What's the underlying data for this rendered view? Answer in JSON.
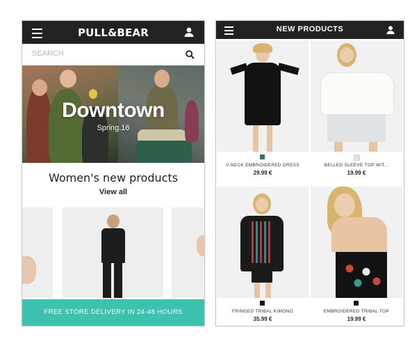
{
  "left_screen": {
    "brand": "PULL&BEAR",
    "search": {
      "placeholder": "SEARCH"
    },
    "hero": {
      "title": "Downtown",
      "subtitle": "Spring.16"
    },
    "section": {
      "title": "Women's new products",
      "link": "View all"
    },
    "banner": "FREE STORE DELIVERY IN 24-48 HOURS",
    "icons": {
      "menu": "hamburger-menu-icon",
      "user": "user-icon",
      "search": "search-icon"
    }
  },
  "right_screen": {
    "title": "NEW PRODUCTS",
    "products": [
      {
        "name": "V-NECK EMBROIDERED DRESS",
        "price": "29.99 €",
        "swatch": "#2a7a5a"
      },
      {
        "name": "BELLED SLEEVE TOP WIT...",
        "price": "19.99 €",
        "swatch": "#e4e4e4"
      },
      {
        "name": "FRINGED TRIBAL KIMONO",
        "price": "35.99 €",
        "swatch": "#111111"
      },
      {
        "name": "EMBROIDERED TRIBAL TOP",
        "price": "19.99 €",
        "swatch": "#111111"
      }
    ]
  },
  "colors": {
    "topbar": "#222222",
    "banner": "#3cc2ae",
    "background": "#ffffff"
  }
}
